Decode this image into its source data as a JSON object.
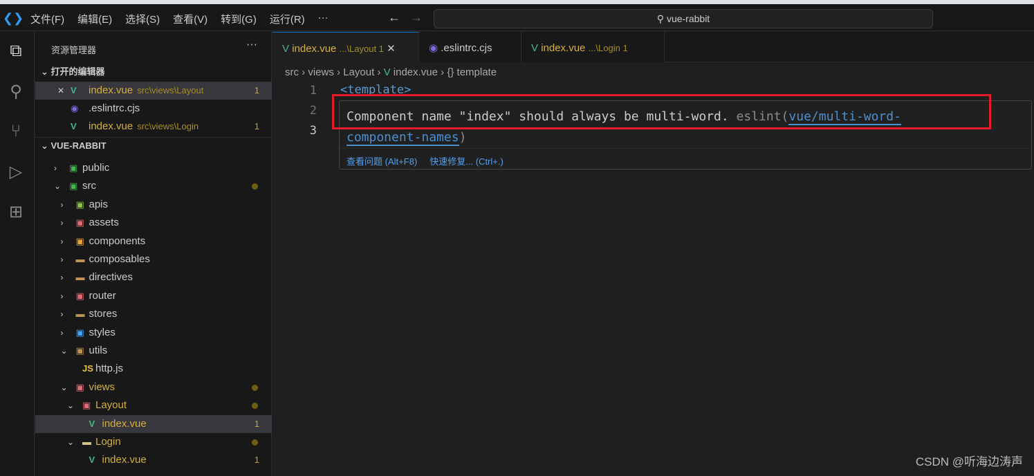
{
  "menu": [
    "文件(F)",
    "编辑(E)",
    "选择(S)",
    "查看(V)",
    "转到(G)",
    "运行(R)",
    "···"
  ],
  "search": "vue-rabbit",
  "sidebar": {
    "title": "资源管理器",
    "more": "···",
    "open_editors": "打开的编辑器",
    "open": [
      {
        "name": "index.vue",
        "desc": "src\\views\\Layout",
        "badge": "1"
      },
      {
        "name": ".eslintrc.cjs",
        "desc": "",
        "badge": ""
      },
      {
        "name": "index.vue",
        "desc": "src\\views\\Login",
        "badge": "1"
      }
    ],
    "project": "VUE-RABBIT",
    "tree": [
      {
        "name": "public"
      },
      {
        "name": "src"
      },
      {
        "name": "apis"
      },
      {
        "name": "assets"
      },
      {
        "name": "components"
      },
      {
        "name": "composables"
      },
      {
        "name": "directives"
      },
      {
        "name": "router"
      },
      {
        "name": "stores"
      },
      {
        "name": "styles"
      },
      {
        "name": "utils"
      },
      {
        "name": "http.js",
        "icon": "JS"
      },
      {
        "name": "views"
      },
      {
        "name": "Layout"
      },
      {
        "name": "index.vue",
        "badge": "1"
      },
      {
        "name": "Login"
      },
      {
        "name": "index.vue",
        "badge": "1"
      }
    ]
  },
  "tabs": [
    {
      "name": "index.vue",
      "sub": "...\\Layout 1",
      "close": "✕"
    },
    {
      "name": ".eslintrc.cjs",
      "sub": ""
    },
    {
      "name": "index.vue",
      "sub": "...\\Login 1"
    }
  ],
  "breadcrumb": [
    "src",
    "views",
    "Layout",
    "index.vue",
    "{} template"
  ],
  "lines": [
    "1",
    "2",
    "3"
  ],
  "code_line1": "<template>",
  "hover": {
    "message": "Component name \"index\" should always be multi-word.",
    "source": "eslint(",
    "rule": "vue/multi-word-component-names",
    "close_paren": ")",
    "view_problem": "查看问题 (Alt+F8)",
    "quick_fix": "快速修复... (Ctrl+.)"
  },
  "watermark": "CSDN @听海边涛声"
}
